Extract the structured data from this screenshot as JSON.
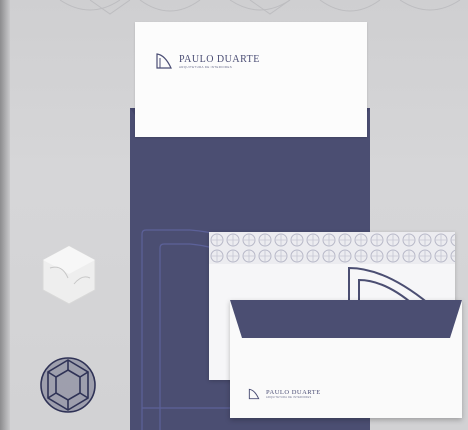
{
  "scene": "stationery-mockup",
  "brand": {
    "name": "PAULO DUARTE",
    "tagline": "ARQUITETURA DE INTERIORES"
  },
  "colors": {
    "navy": "#4b4e72",
    "folder_line": "#5c6199",
    "paper": "#fafafa",
    "background": "#d4d4d6"
  }
}
